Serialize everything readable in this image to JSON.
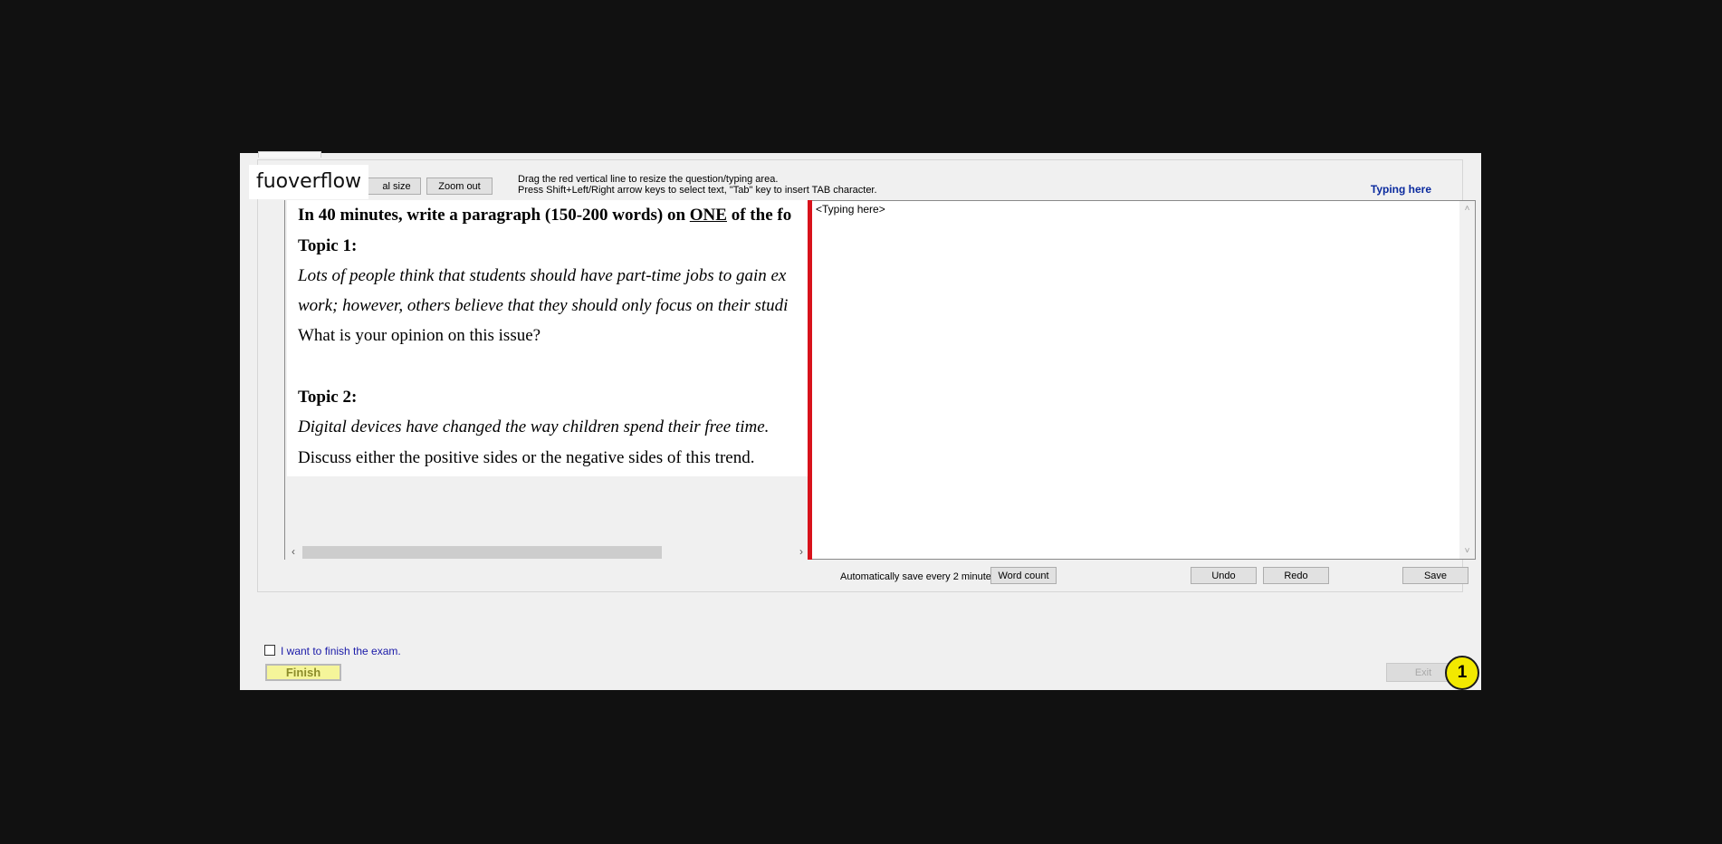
{
  "watermark": "fuoverflow",
  "toolbar": {
    "actual_size_partial": "al size",
    "zoom_out": "Zoom out",
    "hint_line1": "Drag the red vertical line to resize the question/typing area.",
    "hint_line2": "Press Shift+Left/Right arrow keys to select text, \"Tab\" key to insert TAB character.",
    "typing_here_title": "Typing here"
  },
  "question": {
    "instruction_before": "In 40 minutes, write a paragraph (150-200 words) on ",
    "instruction_emph": "ONE",
    "instruction_after": " of the fo",
    "topic1_title": "Topic 1:",
    "topic1_line1": " Lots of people think that students should have part-time jobs to gain ex",
    "topic1_line2": "work; however, others believe that they should only focus on their studi",
    "topic1_line3": "What is your opinion on this issue?",
    "topic2_title": "Topic 2:",
    "topic2_line1": "Digital devices have changed the way children spend their free time.",
    "topic2_line2": "Discuss either the positive sides or the negative sides of this trend."
  },
  "editor": {
    "content": "<Typing here>"
  },
  "bottom_bar": {
    "autosave_note": "Automatically save every 2 minutes.",
    "word_count": "Word count",
    "undo": "Undo",
    "redo": "Redo",
    "save": "Save"
  },
  "finish": {
    "checkbox_label": "I want to finish the exam.",
    "checkbox_checked": false,
    "finish_button": "Finish",
    "exit_button": "Exit"
  },
  "step_badge": "1",
  "colors": {
    "splitter": "#d8121b",
    "typing_title": "#0a2a9e",
    "finish_button_bg": "#f5f59a",
    "badge": "#f2e900"
  }
}
